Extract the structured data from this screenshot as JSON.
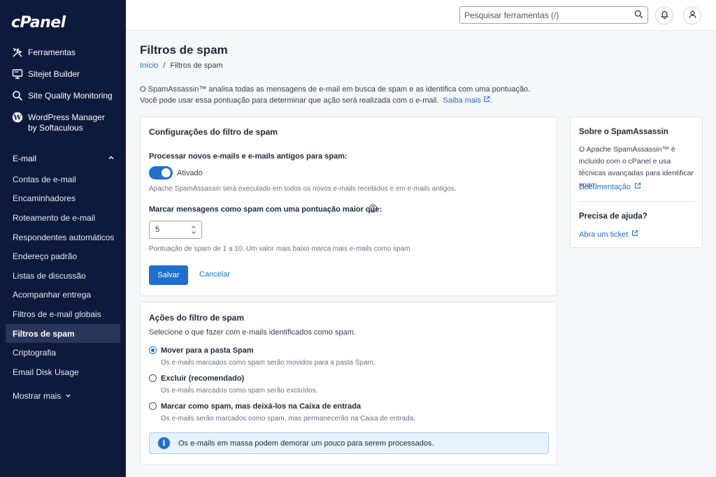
{
  "brand": {
    "logo": "cPanel"
  },
  "sidebar": {
    "top_items": [
      {
        "label": "Ferramentas",
        "icon": "tools-icon"
      },
      {
        "label": "Sitejet Builder",
        "icon": "monitor-icon"
      },
      {
        "label": "Site Quality Monitoring",
        "icon": "search-icon"
      },
      {
        "label": "WordPress Manager",
        "label2": "by Softaculous",
        "icon": "wordpress-icon"
      }
    ],
    "section": "E-mail",
    "sub_items": [
      {
        "label": "Contas de e-mail"
      },
      {
        "label": "Encaminhadores"
      },
      {
        "label": "Roteamento de e-mail"
      },
      {
        "label": "Respondentes automáticos"
      },
      {
        "label": "Endereço padrão"
      },
      {
        "label": "Listas de discussão"
      },
      {
        "label": "Acompanhar entrega"
      },
      {
        "label": "Filtros de e-mail globais"
      },
      {
        "label": "Filtros de spam",
        "active": true
      },
      {
        "label": "Criptografia"
      },
      {
        "label": "Email Disk Usage"
      }
    ],
    "show_more": "Mostrar mais"
  },
  "topbar": {
    "search_placeholder": "Pesquisar ferramentas (/)"
  },
  "page": {
    "title": "Filtros de spam",
    "breadcrumb": {
      "home": "Início",
      "sep": "/",
      "current": "Filtros de spam"
    },
    "intro": "O SpamAssassin™ analisa todas as mensagens de e-mail em busca de spam e as identifica com uma pontuação. Você pode usar essa pontuação para determinar que ação será realizada com o e-mail.",
    "intro_link": "Saiba mais",
    "intro_end": "."
  },
  "settings": {
    "title": "Configurações do filtro de spam",
    "process_label": "Processar novos e-mails e e-mails antigos para spam:",
    "toggle_state": "Ativado",
    "toggle_help": "Apache SpamAssassin será executado em todos os novos e-mails recebidos e em e-mails antigos.",
    "score_label": "Marcar mensagens como spam com uma pontuação maior que:",
    "score_value": "5",
    "score_help": "Pontuação de spam de 1 a 10. Um valor mais baixo marca mais e-mails como spam.",
    "save": "Salvar",
    "cancel": "Cancelar"
  },
  "actions": {
    "title": "Ações do filtro de spam",
    "subtitle": "Selecione o que fazer com e-mails identificados como spam.",
    "options": [
      {
        "label": "Mover para a pasta Spam",
        "desc": "Os e-mails marcados como spam serão movidos para a pasta Spam.",
        "checked": true
      },
      {
        "label": "Excluir (recomendado)",
        "desc": "Os e-mails marcados como spam serão excluídos.",
        "checked": false
      },
      {
        "label": "Marcar como spam, mas deixá-los na Caixa de entrada",
        "desc": "Os e-mails serão marcados como spam, mas permanecerão na Caixa de entrada.",
        "checked": false
      }
    ],
    "alert": "Os e-mails em massa podem demorar um pouco para serem processados."
  },
  "side": {
    "about_title": "Sobre o SpamAssassin",
    "about_text": "O Apache SpamAssassin™ é incluído com o cPanel e usa técnicas avançadas para identificar spam.",
    "doc_link": "Documentação",
    "help_title": "Precisa de ajuda?",
    "ticket_link": "Abra um ticket"
  },
  "colors": {
    "sidebar_bg": "#0e1a3c",
    "accent": "#1f6fcf",
    "alert_bg": "#e6f2fc"
  }
}
